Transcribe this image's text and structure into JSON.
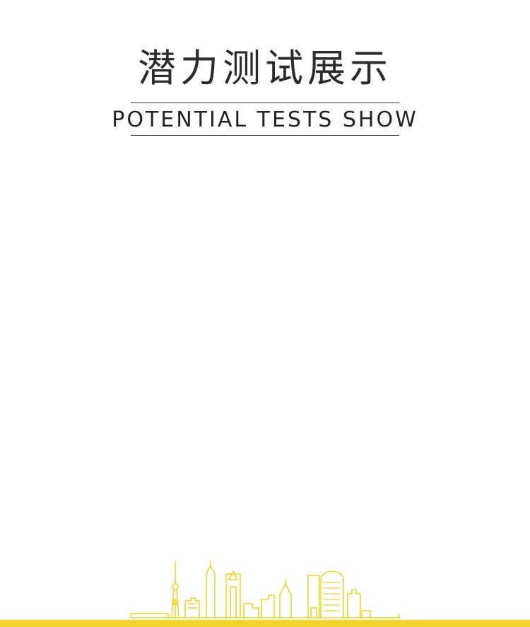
{
  "header": {
    "title_zh": "潜力测试展示",
    "title_en": "POTENTIAL TESTS SHOW"
  },
  "colors": {
    "accent": "#f2d32a",
    "text": "#2b2b2b",
    "rule": "#333333"
  },
  "decoration": {
    "skyline": "city-skyline-illustration"
  }
}
